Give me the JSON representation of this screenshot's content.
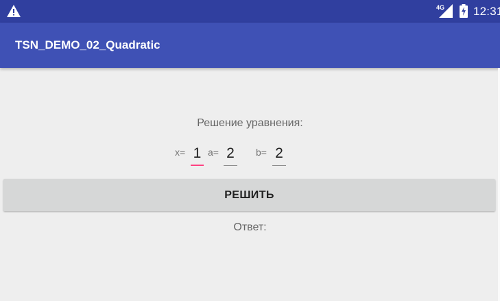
{
  "status_bar": {
    "network": "4G",
    "time": "12:31",
    "icons": [
      "warning-icon",
      "signal-4g-icon",
      "battery-charging-icon"
    ]
  },
  "app_bar": {
    "title": "TSN_DEMO_02_Quadratic"
  },
  "main": {
    "heading": "Решение уравнения:",
    "fields": [
      {
        "label": "x=",
        "value": "1",
        "focused": true
      },
      {
        "label": "a=",
        "value": "2",
        "focused": false
      },
      {
        "label": "b=",
        "value": "2",
        "focused": false
      }
    ],
    "solve_button": "РЕШИТЬ",
    "answer": "Ответ:"
  },
  "colors": {
    "status_bar": "#303f9f",
    "app_bar": "#3f51b5",
    "background": "#eeeeee",
    "focus_underline": "#ff4081",
    "button": "#d6d7d7"
  }
}
